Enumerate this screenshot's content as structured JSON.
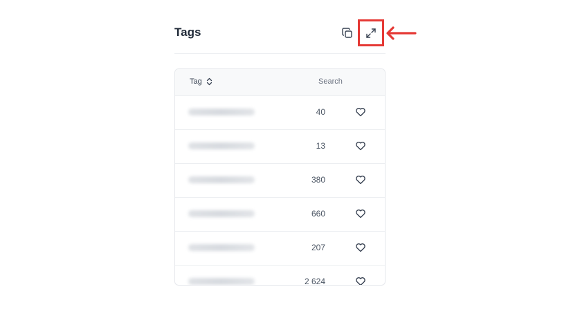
{
  "header": {
    "title": "Tags"
  },
  "table": {
    "columns": {
      "tag": "Tag",
      "search": "Search"
    },
    "rows": [
      {
        "search": "40"
      },
      {
        "search": "13"
      },
      {
        "search": "380"
      },
      {
        "search": "660"
      },
      {
        "search": "207"
      },
      {
        "search": "2 624"
      }
    ]
  },
  "colors": {
    "annotation": "#e53935",
    "text": "#1f2937",
    "muted": "#6b7280"
  },
  "icons": [
    "copy-icon",
    "expand-icon",
    "sort-icon",
    "heart-icon",
    "arrow-icon"
  ]
}
